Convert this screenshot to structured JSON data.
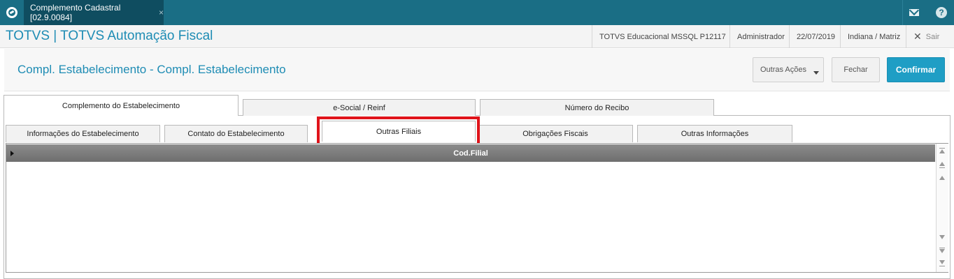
{
  "topbar": {
    "tab_label": "Complemento Cadastral [02.9.0084]",
    "tab_close": "×",
    "icons": [
      "totvs-logo-icon",
      "mail-icon",
      "help-icon"
    ]
  },
  "app": {
    "title": "TOTVS | TOTVS Automação Fiscal",
    "environment": "TOTVS Educacional MSSQL P12117",
    "user": "Administrador",
    "date": "22/07/2019",
    "branch": "Indiana / Matriz",
    "exit_label": "Sair"
  },
  "page": {
    "title": "Compl. Estabelecimento - Compl. Estabelecimento",
    "actions": {
      "more": "Outras Ações",
      "close": "Fechar",
      "confirm": "Confirmar"
    }
  },
  "tabs_level1": [
    "Complemento do Estabelecimento",
    "e-Social / Reinf",
    "Número do Recibo"
  ],
  "tabs_level2": [
    "Informações do Estabelecimento",
    "Contato do Estabelecimento",
    "Outras Filiais",
    "Obrigações Fiscais",
    "Outras Informações"
  ],
  "grid": {
    "column_header": "Cod.Filial",
    "rows": []
  },
  "colors": {
    "topbar": "#1a6e85",
    "accent": "#1e8cb4",
    "confirm_button": "#1f9ec5",
    "highlight": "#e0141b"
  }
}
